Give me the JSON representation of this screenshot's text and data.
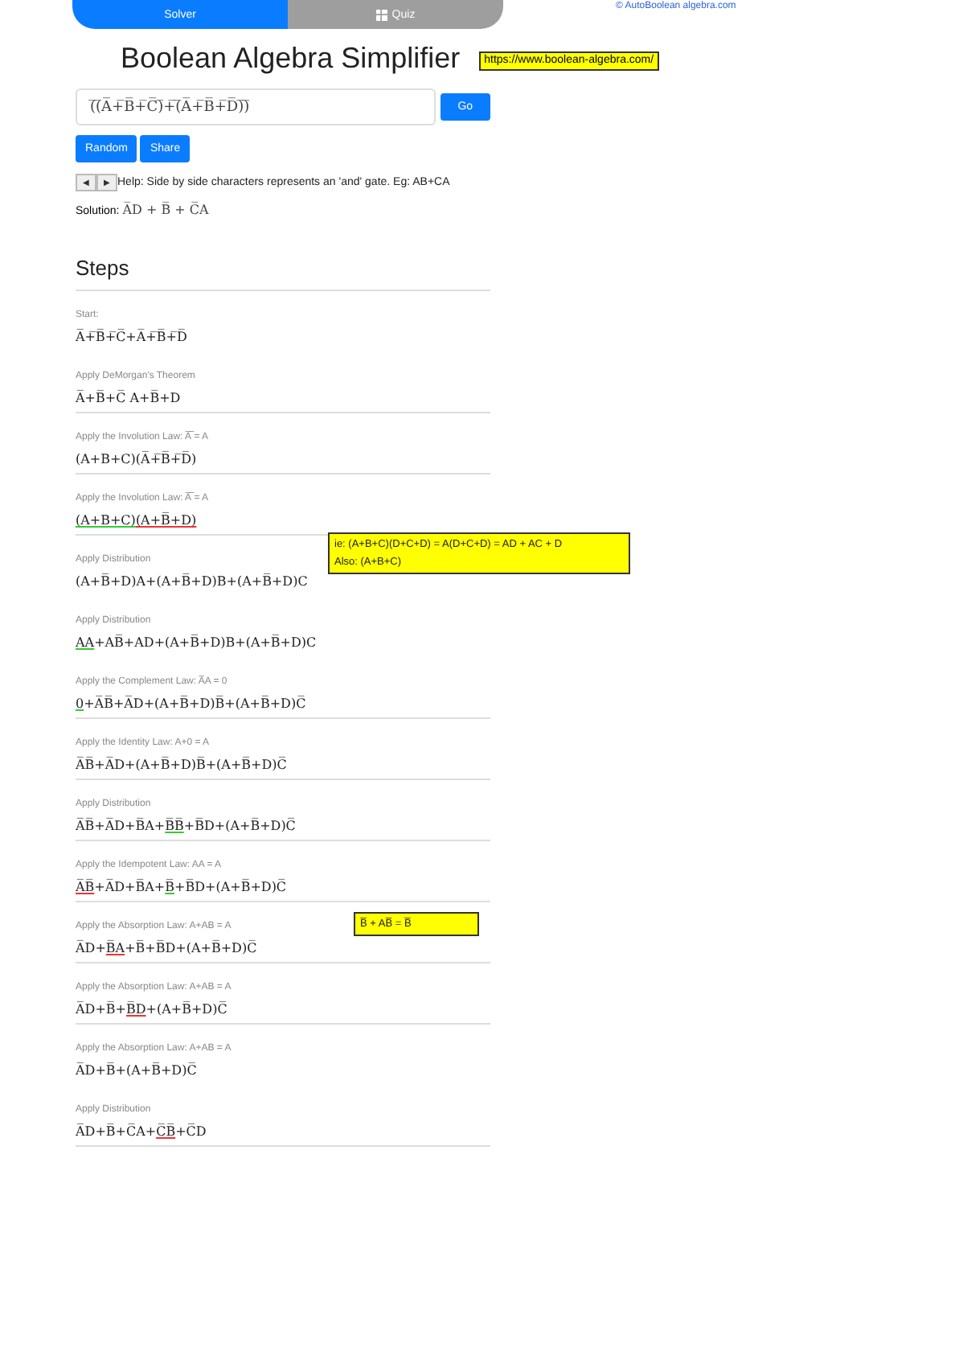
{
  "tabs": [
    {
      "label": "Solver",
      "selected": true,
      "icon": false
    },
    {
      "label": "Quiz",
      "selected": false,
      "icon": true
    }
  ],
  "credit_link": "© AutoBoolean algebra.com",
  "title": "Boolean Algebra Simplifier",
  "url_note": "https://www.boolean-algebra.com/",
  "input": {
    "value": "(̅(̅A̅+̅B̅+̅C̅)̅+̅(̅A̅+̅B̅+̅D̅)̅)̅"
  },
  "go_button": "Go",
  "buttons": [
    "Random",
    "Share"
  ],
  "arrows": [
    "◀",
    "▶"
  ],
  "help": "Help: Side by side characters represents an 'and' gate. Eg: AB+CA",
  "solution": {
    "label": "Solution:",
    "value": "A̅D + B̅ + C̅A"
  },
  "steps_heading": "Steps",
  "steps": [
    {
      "label": "Start:",
      "expr": [
        {
          "text": "A̅+̅B̅+̅C̅+A̅+̅B̅+̅D̅",
          "kind": "plain"
        }
      ],
      "divider_below": false
    },
    {
      "label": "Apply DeMorgan's Theorem",
      "expr": [
        {
          "text": "A̅+B̅+C̅ A+B̅+D",
          "kind": "plain"
        }
      ],
      "divider_below": true
    },
    {
      "label": "Apply the Involution Law: A̅̅ = A",
      "expr": [
        {
          "text": "(A+B+C)(A̅+̅B̅+̅D̅)",
          "kind": "plain"
        }
      ],
      "divider_below": true
    },
    {
      "label": "Apply the Involution Law: A̅̅ = A",
      "expr": [
        {
          "text": "(A+B+C)",
          "kind": "applied"
        },
        {
          "text": "(A+B̅+D)",
          "kind": "removed"
        }
      ],
      "divider_below": true
    },
    {
      "label": "Apply Distribution",
      "expr": [
        {
          "text": "(A+B̅+D)A+(A+B̅+D)B+(A+B̅+D)C",
          "kind": "plain"
        }
      ],
      "divider_below": false,
      "note": [
        "ie: (A+B+C)(D+C+D) = A(D+C+D) = AD + AC + D",
        "Also: (A+B+C)"
      ]
    },
    {
      "label": "Apply Distribution",
      "expr": [
        {
          "text": "AA",
          "kind": "applied"
        },
        {
          "text": "+AB̅+AD+(A+B̅+D)B+(A+B̅+D)C",
          "kind": "plain"
        }
      ],
      "divider_below": false
    },
    {
      "label": "Apply the Complement Law: A̅A = 0",
      "expr": [
        {
          "text": "0",
          "kind": "applied"
        },
        {
          "text": "+A̅B̅+A̅D+(A+B̅+D)B̅+(A+B̅+D)C̅",
          "kind": "plain"
        }
      ],
      "divider_below": true
    },
    {
      "label": "Apply the Identity Law: A+0 = A",
      "expr": [
        {
          "text": "A̅B̅+A̅D+(A+B̅+D)B̅+(A+B̅+D)C̅",
          "kind": "plain"
        }
      ],
      "divider_below": true
    },
    {
      "label": "Apply Distribution",
      "expr": [
        {
          "text": "A̅B̅+A̅D+B̅A+",
          "kind": "plain"
        },
        {
          "text": "B̅B̅",
          "kind": "applied"
        },
        {
          "text": "+B̅D+(A+B̅+D)C̅",
          "kind": "plain"
        }
      ],
      "divider_below": true
    },
    {
      "label": "Apply the Idempotent Law: AA = A",
      "expr": [
        {
          "text": "A̅B̅",
          "kind": "removed"
        },
        {
          "text": "+A̅D+B̅A+",
          "kind": "plain"
        },
        {
          "text": "B̅",
          "kind": "applied"
        },
        {
          "text": "+B̅D+(A+B̅+D)C̅",
          "kind": "plain"
        }
      ],
      "divider_below": true
    },
    {
      "label": "Apply the Absorption Law: A+AB = A",
      "expr": [
        {
          "text": "A̅D+",
          "kind": "plain"
        },
        {
          "text": "B̅A",
          "kind": "removed"
        },
        {
          "text": "+B̅+B̅D+(A+B̅+D)C̅",
          "kind": "plain"
        }
      ],
      "divider_below": true,
      "note": [
        "B̅ + AB̅ = B̅"
      ]
    },
    {
      "label": "Apply the Absorption Law: A+AB = A",
      "expr": [
        {
          "text": "A̅D+B̅+",
          "kind": "plain"
        },
        {
          "text": "B̅D",
          "kind": "removed"
        },
        {
          "text": "+(A+B̅+D)C̅",
          "kind": "plain"
        }
      ],
      "divider_below": true
    },
    {
      "label": "Apply the Absorption Law: A+AB = A",
      "expr": [
        {
          "text": "A̅D+B̅+(A+B̅+D)C̅",
          "kind": "plain"
        }
      ],
      "divider_below": false
    },
    {
      "label": "Apply Distribution",
      "expr": [
        {
          "text": "A̅D+B̅+C̅A+",
          "kind": "plain"
        },
        {
          "text": "C̅B̅",
          "kind": "removed"
        },
        {
          "text": "+C̅D",
          "kind": "plain"
        }
      ],
      "divider_below": true
    }
  ]
}
